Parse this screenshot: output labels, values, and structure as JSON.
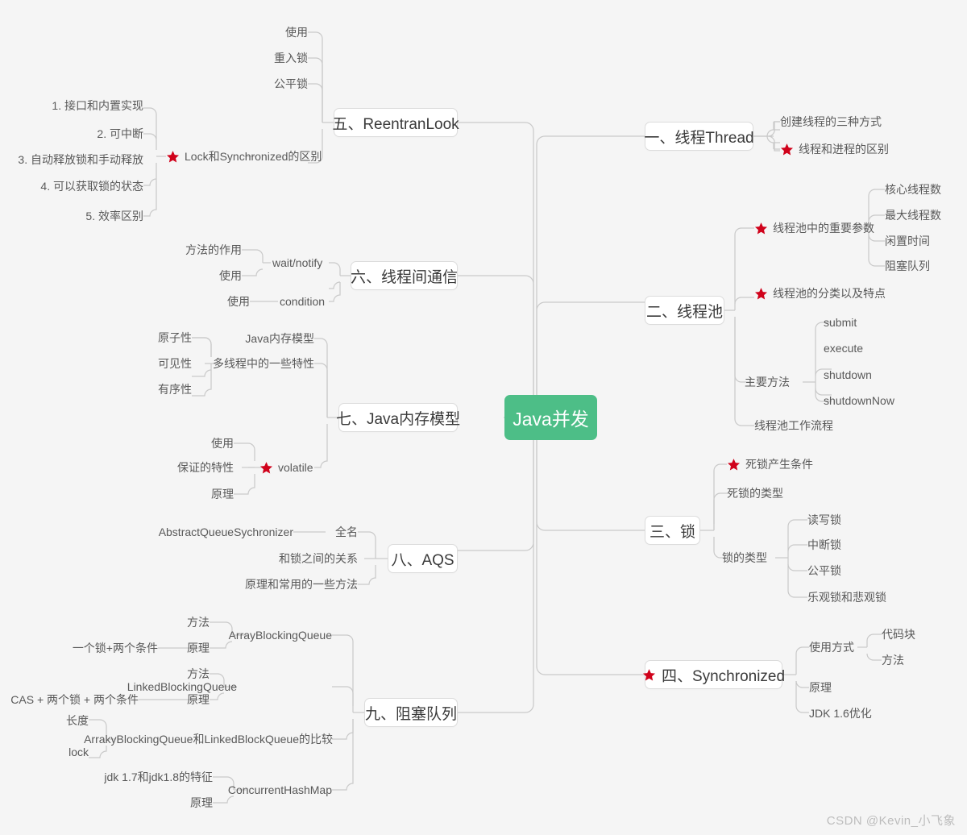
{
  "meta": {
    "root_color": "#4dbe87",
    "star_color": "#d0021b",
    "line_color": "#c9c9c9",
    "background": "#f5f5f5",
    "watermark": "CSDN @Kevin_小飞象"
  },
  "root": {
    "label": "Java并发"
  },
  "branches": {
    "thread": {
      "label": "一、线程Thread",
      "children": [
        {
          "label": "创建线程的三种方式",
          "star": false
        },
        {
          "label": "线程和进程的区别",
          "star": true
        }
      ]
    },
    "threadpool": {
      "label": "二、线程池",
      "children": [
        {
          "label": "线程池中的重要参数",
          "star": true,
          "children": [
            "核心线程数",
            "最大线程数",
            "闲置时间",
            "阻塞队列"
          ]
        },
        {
          "label": "线程池的分类以及特点",
          "star": true
        },
        {
          "label": "主要方法",
          "star": false,
          "children": [
            "submit",
            "execute",
            "shutdown",
            "shutdownNow"
          ]
        },
        {
          "label": "线程池工作流程",
          "star": false
        }
      ]
    },
    "lock": {
      "label": "三、锁",
      "children": [
        {
          "label": "死锁产生条件",
          "star": true
        },
        {
          "label": "死锁的类型",
          "star": false
        },
        {
          "label": "锁的类型",
          "star": false,
          "children": [
            "读写锁",
            "中断锁",
            "公平锁",
            "乐观锁和悲观锁"
          ]
        }
      ]
    },
    "synchronized": {
      "label": "四、Synchronized",
      "star": true,
      "children": [
        {
          "label": "使用方式",
          "star": false,
          "children": [
            "代码块",
            "方法"
          ]
        },
        {
          "label": "原理",
          "star": false
        },
        {
          "label": "JDK 1.6优化",
          "star": false
        }
      ]
    },
    "reentranlook": {
      "label": "五、ReentranLook",
      "children": [
        {
          "label": "使用",
          "star": false
        },
        {
          "label": "重入锁",
          "star": false
        },
        {
          "label": "公平锁",
          "star": false
        },
        {
          "label": "Lock和Synchronized的区别",
          "star": true,
          "children": [
            "1. 接口和内置实现",
            "2. 可中断",
            "3. 自动释放锁和手动释放",
            "4. 可以获取锁的状态",
            "5. 效率区别"
          ]
        }
      ]
    },
    "communication": {
      "label": "六、线程间通信",
      "children": [
        {
          "label": "wait/notify",
          "star": false,
          "children": [
            "方法的作用",
            "使用"
          ]
        },
        {
          "label": "condition",
          "star": false,
          "children": [
            "使用"
          ]
        }
      ]
    },
    "jmm": {
      "label": "七、Java内存模型",
      "children": [
        {
          "label": "Java内存模型",
          "star": false
        },
        {
          "label": "多线程中的一些特性",
          "star": false,
          "children": [
            "原子性",
            "可见性",
            "有序性"
          ]
        },
        {
          "label": "volatile",
          "star": true,
          "children": [
            "使用",
            "保证的特性",
            "原理"
          ]
        }
      ]
    },
    "aqs": {
      "label": "八、AQS",
      "children": [
        {
          "label": "全名",
          "star": false,
          "children": [
            "AbstractQueueSychronizer"
          ]
        },
        {
          "label": "和锁之间的关系",
          "star": false
        },
        {
          "label": "原理和常用的一些方法",
          "star": false
        }
      ]
    },
    "blockingqueue": {
      "label": "九、阻塞队列",
      "children": [
        {
          "label": "ArrayBlockingQueue",
          "star": false,
          "children": [
            {
              "label": "方法"
            },
            {
              "label": "原理",
              "children": [
                "一个锁+两个条件"
              ]
            }
          ]
        },
        {
          "label": "LinkedBlockingQueue",
          "star": false,
          "children": [
            {
              "label": "方法"
            },
            {
              "label": "原理",
              "children": [
                "CAS + 两个锁 + 两个条件"
              ]
            }
          ]
        },
        {
          "label": "ArrakyBlockingQueue和LinkedBlockQueue的比较",
          "star": false,
          "children": [
            "长度",
            "lock"
          ]
        },
        {
          "label": "ConcurrentHashMap",
          "star": false,
          "children": [
            "jdk 1.7和jdk1.8的特征",
            "原理"
          ]
        }
      ]
    }
  }
}
